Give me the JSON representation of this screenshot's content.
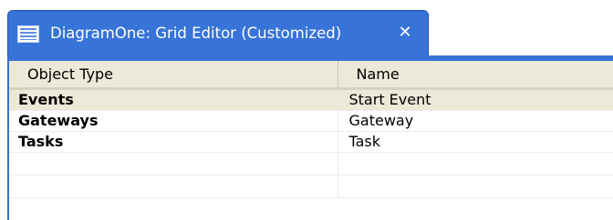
{
  "editor_tab": {
    "title": "DiagramOne: Grid Editor (Customized)",
    "icon": "grid-editor-icon",
    "close_icon": "close-icon"
  },
  "grid": {
    "columns": [
      "Object Type",
      "Name"
    ],
    "rows": [
      {
        "object_type": "Events",
        "name": "Start Event"
      },
      {
        "object_type": "Gateways",
        "name": "Gateway"
      },
      {
        "object_type": "Tasks",
        "name": "Task"
      }
    ],
    "selected_row": 0
  },
  "colors": {
    "tab_active": "#3773d8",
    "header_bg": "#ece9d8",
    "row_selected": "#ece9d8"
  }
}
